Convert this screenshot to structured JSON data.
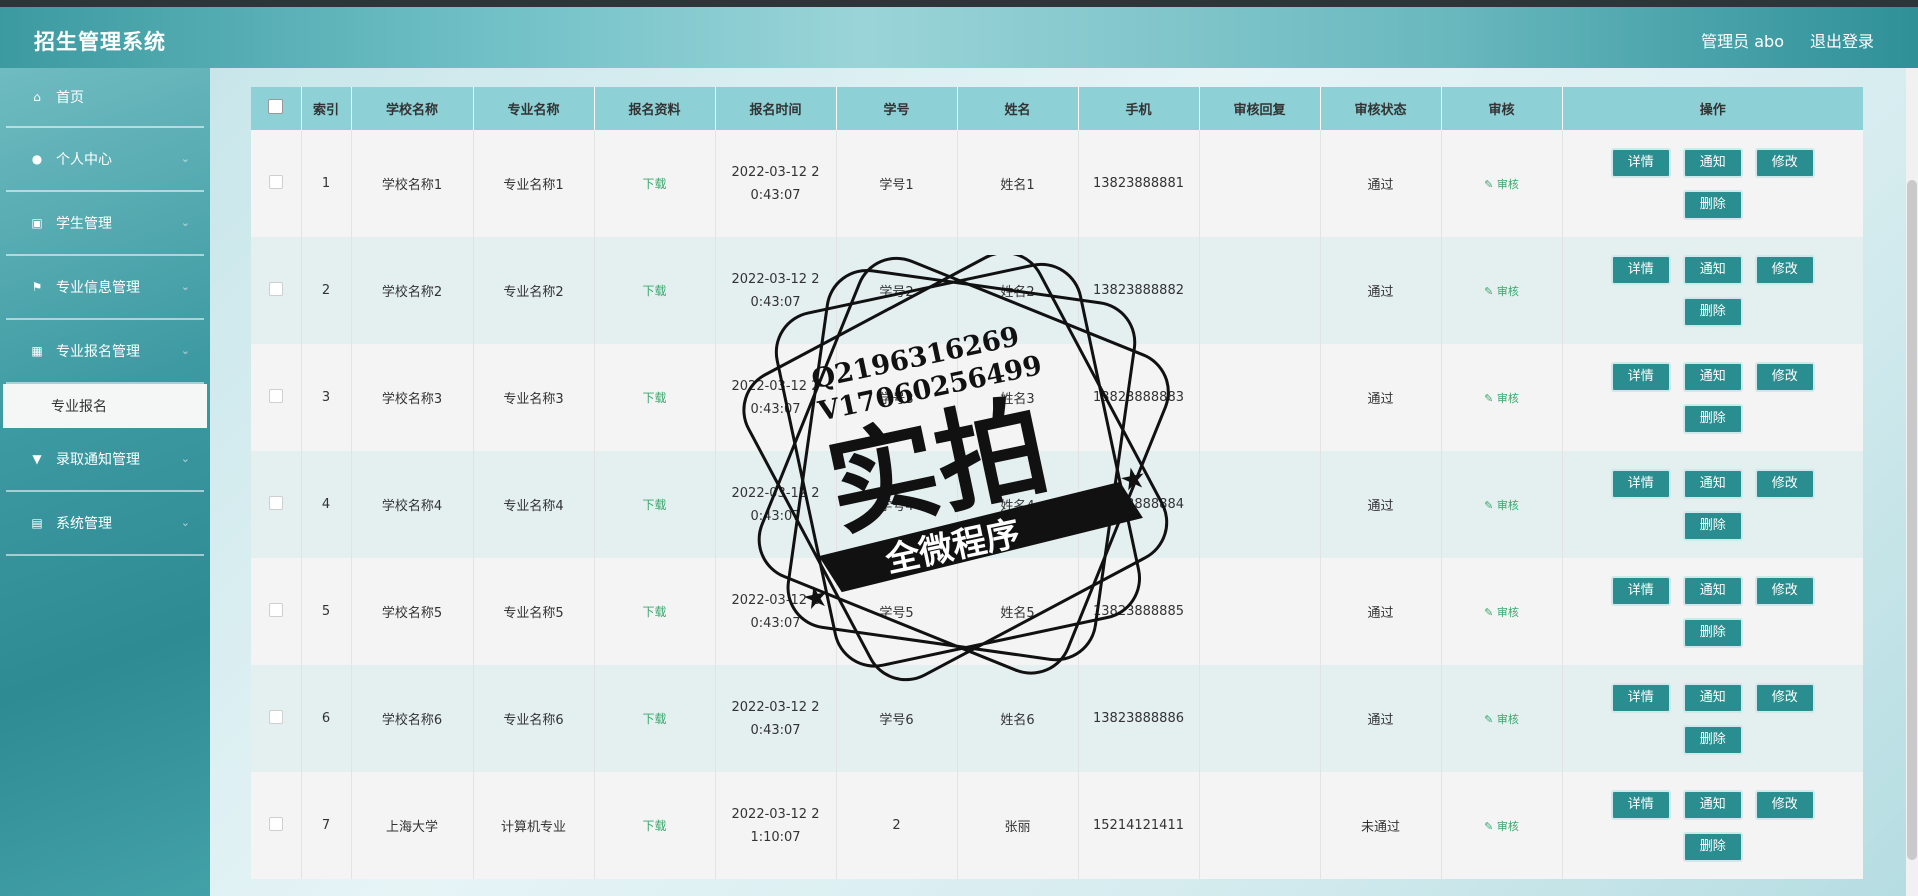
{
  "header": {
    "title": "招生管理系统",
    "admin_label": "管理员 abo",
    "logout": "退出登录"
  },
  "sidebar": {
    "items": [
      {
        "label": "首页",
        "icon": "home-icon",
        "glyph": "⌂"
      },
      {
        "label": "个人中心",
        "icon": "user-icon",
        "glyph": "●"
      },
      {
        "label": "学生管理",
        "icon": "clipboard-icon",
        "glyph": "▣"
      },
      {
        "label": "专业信息管理",
        "icon": "flag-icon",
        "glyph": "⚑"
      },
      {
        "label": "专业报名管理",
        "icon": "grid-icon",
        "glyph": "▦"
      }
    ],
    "active_sub": "专业报名",
    "items2": [
      {
        "label": "录取通知管理",
        "icon": "stamp-icon",
        "glyph": "▼"
      },
      {
        "label": "系统管理",
        "icon": "settings-icon",
        "glyph": "▤"
      }
    ]
  },
  "table": {
    "headers": [
      "索引",
      "学校名称",
      "专业名称",
      "报名资料",
      "报名时间",
      "学号",
      "姓名",
      "手机",
      "审核回复",
      "审核状态",
      "审核",
      "操作"
    ],
    "download_label": "下载",
    "audit_label": "审核",
    "buttons": {
      "detail": "详情",
      "notify": "通知",
      "edit": "修改",
      "delete": "删除"
    },
    "rows": [
      {
        "index": "1",
        "school": "学校名称1",
        "major": "专业名称1",
        "time1": "2022-03-12 2",
        "time2": "0:43:07",
        "student_no": "学号1",
        "name": "姓名1",
        "phone": "13823888881",
        "reply": "",
        "status": "通过"
      },
      {
        "index": "2",
        "school": "学校名称2",
        "major": "专业名称2",
        "time1": "2022-03-12 2",
        "time2": "0:43:07",
        "student_no": "学号2",
        "name": "姓名2",
        "phone": "13823888882",
        "reply": "",
        "status": "通过"
      },
      {
        "index": "3",
        "school": "学校名称3",
        "major": "专业名称3",
        "time1": "2022-03-12 2",
        "time2": "0:43:07",
        "student_no": "学号3",
        "name": "姓名3",
        "phone": "13823888883",
        "reply": "",
        "status": "通过"
      },
      {
        "index": "4",
        "school": "学校名称4",
        "major": "专业名称4",
        "time1": "2022-03-12 2",
        "time2": "0:43:07",
        "student_no": "学号4",
        "name": "姓名4",
        "phone": "13823888884",
        "reply": "",
        "status": "通过"
      },
      {
        "index": "5",
        "school": "学校名称5",
        "major": "专业名称5",
        "time1": "2022-03-12 2",
        "time2": "0:43:07",
        "student_no": "学号5",
        "name": "姓名5",
        "phone": "13823888885",
        "reply": "",
        "status": "通过"
      },
      {
        "index": "6",
        "school": "学校名称6",
        "major": "专业名称6",
        "time1": "2022-03-12 2",
        "time2": "0:43:07",
        "student_no": "学号6",
        "name": "姓名6",
        "phone": "13823888886",
        "reply": "",
        "status": "通过"
      },
      {
        "index": "7",
        "school": "上海大学",
        "major": "计算机专业",
        "time1": "2022-03-12 2",
        "time2": "1:10:07",
        "student_no": "2",
        "name": "张丽",
        "phone": "15214121411",
        "reply": "",
        "status": "未通过"
      }
    ]
  },
  "watermark": {
    "line1": "Q2196316269",
    "line2": "V17060256499",
    "main": "实拍",
    "banner": "全微程序"
  }
}
